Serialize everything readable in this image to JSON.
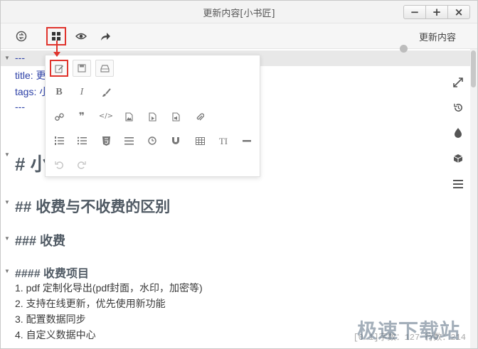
{
  "window": {
    "title": "更新内容[小书匠]",
    "controls": {
      "minimize": "−",
      "maximize": "+",
      "close": "×"
    }
  },
  "toolbar": {
    "update_label": "更新内容",
    "icons": [
      "sync-icon",
      "grid-icon",
      "eye-icon",
      "share-arrow-icon"
    ]
  },
  "editor": {
    "lines": [
      {
        "text": "---",
        "kind": "frontmatter"
      },
      {
        "text": "title: 更",
        "kind": "frontmatter"
      },
      {
        "text": "tags: 小",
        "kind": "frontmatter"
      },
      {
        "text": "---",
        "kind": "frontmatter"
      },
      {
        "text": "# 小",
        "kind": "h1"
      },
      {
        "text": "## 收费与不收费的区别",
        "kind": "h2"
      },
      {
        "text": "### 收费",
        "kind": "h3"
      },
      {
        "text": "#### 收费项目",
        "kind": "h4"
      },
      {
        "text": "1. pdf 定制化导出(pdf封面，水印，加密等)",
        "kind": "list"
      },
      {
        "text": "2. 支持在线更新，优先使用新功能",
        "kind": "list"
      },
      {
        "text": "3. 配置数据同步",
        "kind": "list"
      },
      {
        "text": "4. 自定义数据中心",
        "kind": "list"
      }
    ],
    "status": "[0.1]字数：127 行数：214",
    "watermark": "极速下载站"
  },
  "popup": {
    "rows": [
      [
        "edit-icon",
        "save-icon",
        "print-icon"
      ],
      [
        "bold-icon",
        "italic-icon",
        "brush-icon"
      ],
      [
        "link-icon",
        "quote-icon",
        "code-icon",
        "image-icon",
        "video-icon",
        "audio-icon",
        "attachment-icon"
      ],
      [
        "ordered-list-icon",
        "unordered-list-icon",
        "html5-icon",
        "align-icon",
        "clock-icon",
        "magnet-icon",
        "table-icon",
        "text-size-icon",
        "horizontal-rule-icon"
      ],
      [
        "undo-icon",
        "redo-icon"
      ]
    ],
    "glyphs": {
      "bold": "B",
      "italic": "I",
      "quote": "❞",
      "code": "</>",
      "text_size": "TI"
    }
  },
  "side_icons": [
    "expand-icon",
    "history-icon",
    "drop-icon",
    "cube-icon",
    "menu-icon"
  ],
  "colors": {
    "accent_red": "#e0342d",
    "frontmatter": "#2b3fa6",
    "heading": "#505a64"
  }
}
